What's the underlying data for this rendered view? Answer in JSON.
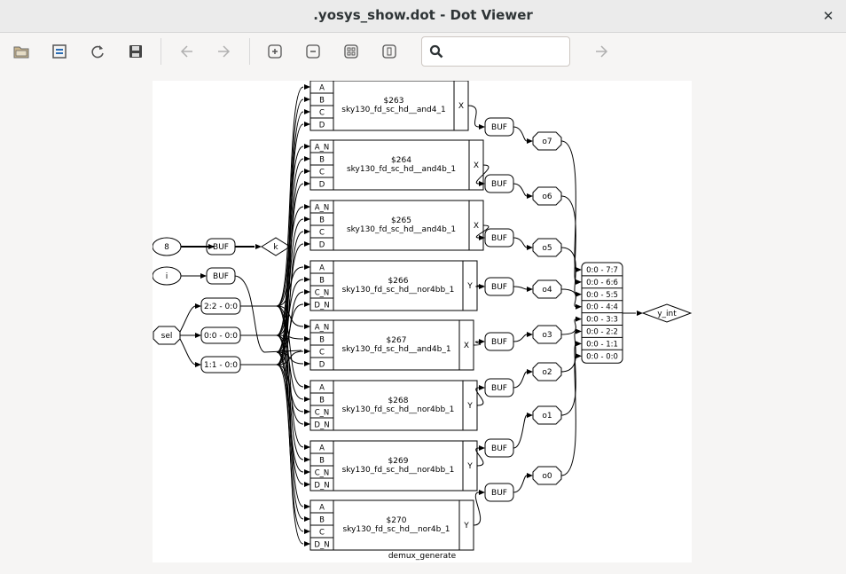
{
  "window": {
    "title": ".yosys_show.dot - Dot Viewer"
  },
  "toolbar": {
    "icons": [
      "open-icon",
      "reload-page-icon",
      "refresh-icon",
      "save-icon",
      "back-icon",
      "forward-icon",
      "zoom-in-icon",
      "zoom-out-icon",
      "zoom-fit-icon",
      "zoom-100-icon"
    ],
    "search": {
      "value": "",
      "placeholder": ""
    },
    "find_next_icon": "find-next-icon"
  },
  "graph": {
    "caption": "demux_generate",
    "inputs": {
      "const": "8",
      "i": "i",
      "sel": "sel"
    },
    "buf_label": "BUF",
    "k": "k",
    "sel_slices": [
      "2:2 - 0:0",
      "0:0 - 0:0",
      "1:1 - 0:0"
    ],
    "cells": [
      {
        "id": "$263",
        "type": "sky130_fd_sc_hd__and4_1",
        "ports": [
          "A",
          "B",
          "C",
          "D"
        ],
        "out": "X"
      },
      {
        "id": "$264",
        "type": "sky130_fd_sc_hd__and4b_1",
        "ports": [
          "A_N",
          "B",
          "C",
          "D"
        ],
        "out": "X"
      },
      {
        "id": "$265",
        "type": "sky130_fd_sc_hd__and4b_1",
        "ports": [
          "A_N",
          "B",
          "C",
          "D"
        ],
        "out": "X"
      },
      {
        "id": "$266",
        "type": "sky130_fd_sc_hd__nor4bb_1",
        "ports": [
          "A",
          "B",
          "C_N",
          "D_N"
        ],
        "out": "Y"
      },
      {
        "id": "$267",
        "type": "sky130_fd_sc_hd__and4b_1",
        "ports": [
          "A_N",
          "B",
          "C",
          "D"
        ],
        "out": "X"
      },
      {
        "id": "$268",
        "type": "sky130_fd_sc_hd__nor4bb_1",
        "ports": [
          "A",
          "B",
          "C_N",
          "D_N"
        ],
        "out": "Y"
      },
      {
        "id": "$269",
        "type": "sky130_fd_sc_hd__nor4bb_1",
        "ports": [
          "A",
          "B",
          "C_N",
          "D_N"
        ],
        "out": "Y"
      },
      {
        "id": "$270",
        "type": "sky130_fd_sc_hd__nor4b_1",
        "ports": [
          "A",
          "B",
          "C",
          "D_N"
        ],
        "out": "Y"
      }
    ],
    "outputs": [
      "o7",
      "o6",
      "o5",
      "o4",
      "o3",
      "o2",
      "o1",
      "o0"
    ],
    "concat": [
      "0:0 - 7:7",
      "0:0 - 6:6",
      "0:0 - 5:5",
      "0:0 - 4:4",
      "0:0 - 3:3",
      "0:0 - 2:2",
      "0:0 - 1:1",
      "0:0 - 0:0"
    ],
    "y_int": "y_int"
  }
}
